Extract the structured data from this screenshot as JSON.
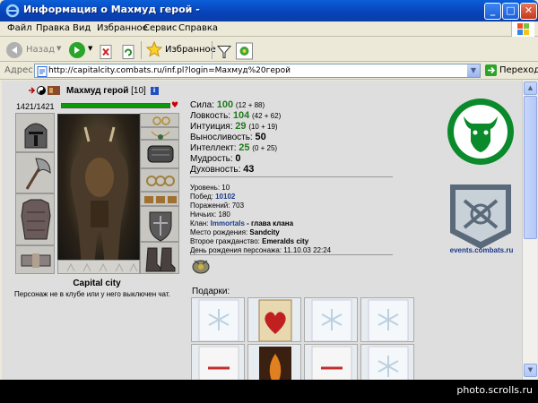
{
  "window": {
    "title": "Информация о Махмуд герой -"
  },
  "menu": [
    "Файл",
    "Правка",
    "Вид",
    "Избранное",
    "Сервис",
    "Справка"
  ],
  "toolbar": {
    "back": "Назад",
    "favorites": "Избранное"
  },
  "address": {
    "label": "Адрес:",
    "url": "http://capitalcity.combats.ru/inf.pl?login=Махмуд%20герой",
    "go": "Переход"
  },
  "character": {
    "name": "Махмуд герой",
    "level": "[10]",
    "hp": "1421/1421",
    "hp_fraction": 1.0,
    "city": "Capital city",
    "status_note": "Персонаж не в клубе или у него выключен чат."
  },
  "stats": [
    {
      "label": "Сила:",
      "value": "100",
      "extra": "(12 + 88)",
      "color": "green"
    },
    {
      "label": "Ловкость:",
      "value": "104",
      "extra": "(42 + 62)",
      "color": "green"
    },
    {
      "label": "Интуиция:",
      "value": "29",
      "extra": "(10 + 19)",
      "color": "green"
    },
    {
      "label": "Выносливость:",
      "value": "50",
      "extra": "",
      "color": "black"
    },
    {
      "label": "Интеллект:",
      "value": "25",
      "extra": "(0 + 25)",
      "color": "green"
    },
    {
      "label": "Мудрость:",
      "value": "0",
      "extra": "",
      "color": "black"
    },
    {
      "label": "Духовность:",
      "value": "43",
      "extra": "",
      "color": "black"
    }
  ],
  "details": {
    "level_label": "Уровень:",
    "level": "10",
    "wins_label": "Побед:",
    "wins": "10102",
    "losses_label": "Поражений:",
    "losses": "703",
    "draws_label": "Ничьих:",
    "draws": "180",
    "clan_label": "Клан:",
    "clan": "Immortals",
    "clan_role": "- глава клана",
    "birthplace_label": "Место рождения:",
    "birthplace": "Sandcity",
    "citizenship_label": "Второе гражданство:",
    "citizenship": "Emeralds city",
    "birthday_label": "День рождения персонажа:",
    "birthday": "11.10.03 22:24"
  },
  "gifts_label": "Подарки:",
  "events_link": "events.combats.ru",
  "watermark": "photo.scrolls.ru",
  "colors": {
    "clan_green": "#0a8a2a",
    "hp_green": "#0a9a0a",
    "xp_blue": "#0842b8"
  }
}
